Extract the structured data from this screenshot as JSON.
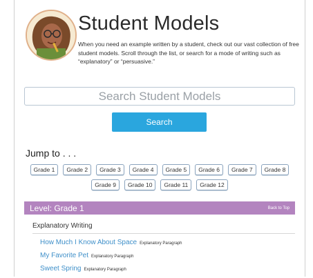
{
  "page": {
    "title": "Student Models",
    "intro": "When you need an example written by a student, check out our vast collection of free student models. Scroll through the list, or search for a mode of writing such as “explanatory” or “persuasive.”"
  },
  "search": {
    "placeholder": "Search Student Models",
    "button_label": "Search"
  },
  "jump": {
    "label": "Jump to . . ."
  },
  "grades": [
    "Grade 1",
    "Grade 2",
    "Grade 3",
    "Grade 4",
    "Grade 5",
    "Grade 6",
    "Grade 7",
    "Grade 8",
    "Grade 9",
    "Grade 10",
    "Grade 11",
    "Grade 12"
  ],
  "level": {
    "label": "Level: Grade 1",
    "back_to_top": "Back to Top",
    "color": "#b384bf"
  },
  "section": {
    "title": "Explanatory Writing"
  },
  "items": [
    {
      "title": "How Much I Know About Space",
      "kind": "Explanatory Paragraph"
    },
    {
      "title": "My Favorite Pet",
      "kind": "Explanatory Paragraph"
    },
    {
      "title": "Sweet Spring",
      "kind": "Explanatory Paragraph"
    }
  ],
  "colors": {
    "accent": "#2aa6de",
    "link": "#3e8fc9"
  },
  "icons": {
    "avatar": "student-avatar-illustration"
  }
}
